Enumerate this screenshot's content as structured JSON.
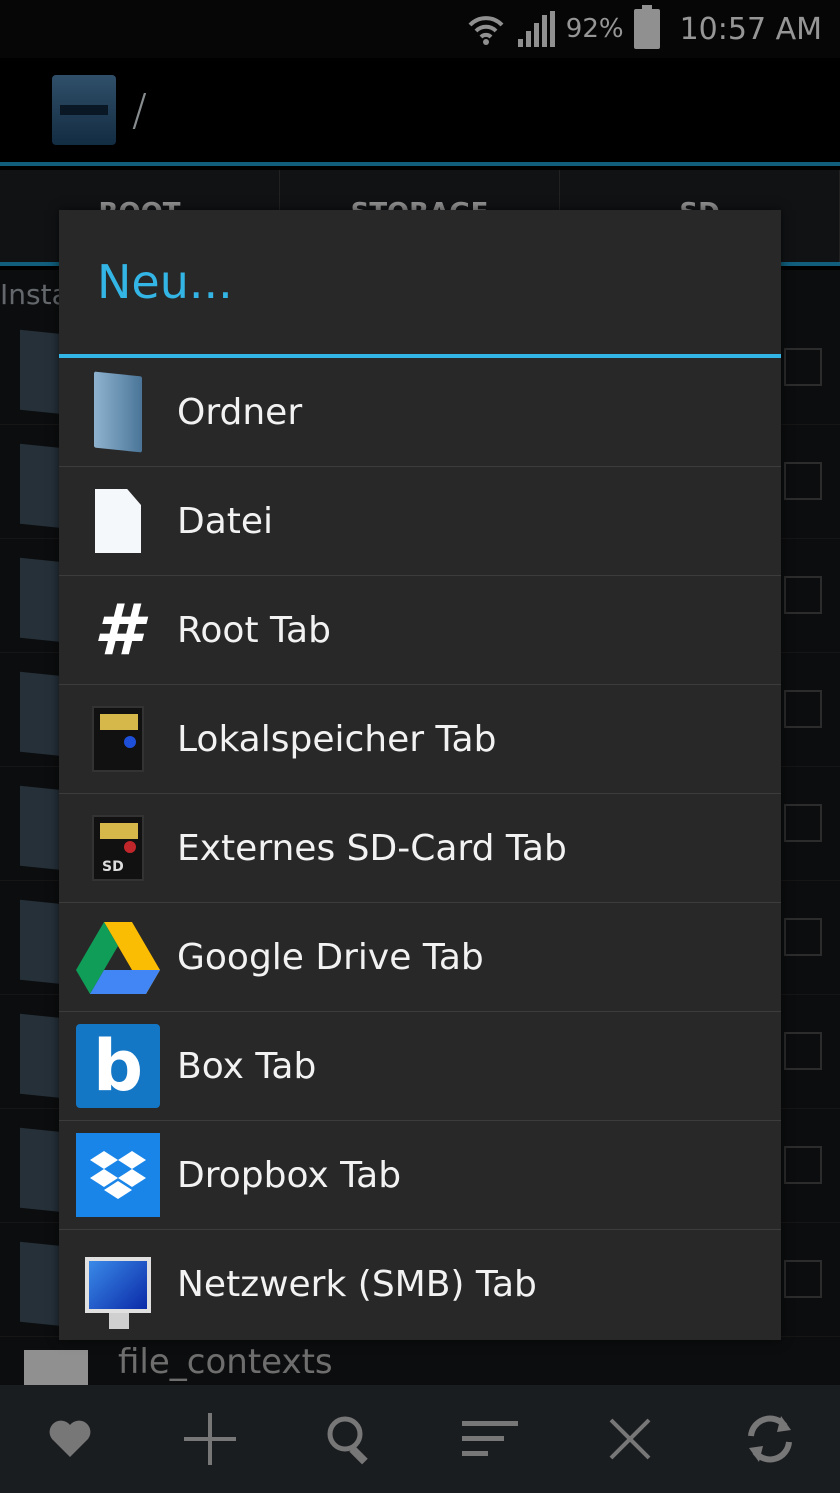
{
  "status_bar": {
    "battery_pct": "92%",
    "time": "10:57 AM"
  },
  "action_bar": {
    "path": "/"
  },
  "tabs": [
    "ROOT",
    "STORAGE",
    "SD"
  ],
  "background": {
    "label": "Insta",
    "filename": "file_contexts"
  },
  "dialog": {
    "title": "Neu...",
    "items": [
      {
        "label": "Ordner",
        "icon": "folder-icon"
      },
      {
        "label": "Datei",
        "icon": "file-icon"
      },
      {
        "label": "Root Tab",
        "icon": "hash-icon"
      },
      {
        "label": "Lokalspeicher Tab",
        "icon": "sd-card-icon"
      },
      {
        "label": "Externes SD-Card Tab",
        "icon": "external-sd-card-icon"
      },
      {
        "label": "Google Drive Tab",
        "icon": "google-drive-icon"
      },
      {
        "label": "Box Tab",
        "icon": "box-icon"
      },
      {
        "label": "Dropbox Tab",
        "icon": "dropbox-icon"
      },
      {
        "label": "Netzwerk (SMB) Tab",
        "icon": "monitor-icon"
      }
    ]
  },
  "colors": {
    "accent": "#33b5e5",
    "dialog_bg": "#282828"
  },
  "toolbar_icons": [
    "heart-icon",
    "plus-icon",
    "search-icon",
    "sort-icon",
    "close-icon",
    "refresh-icon"
  ]
}
